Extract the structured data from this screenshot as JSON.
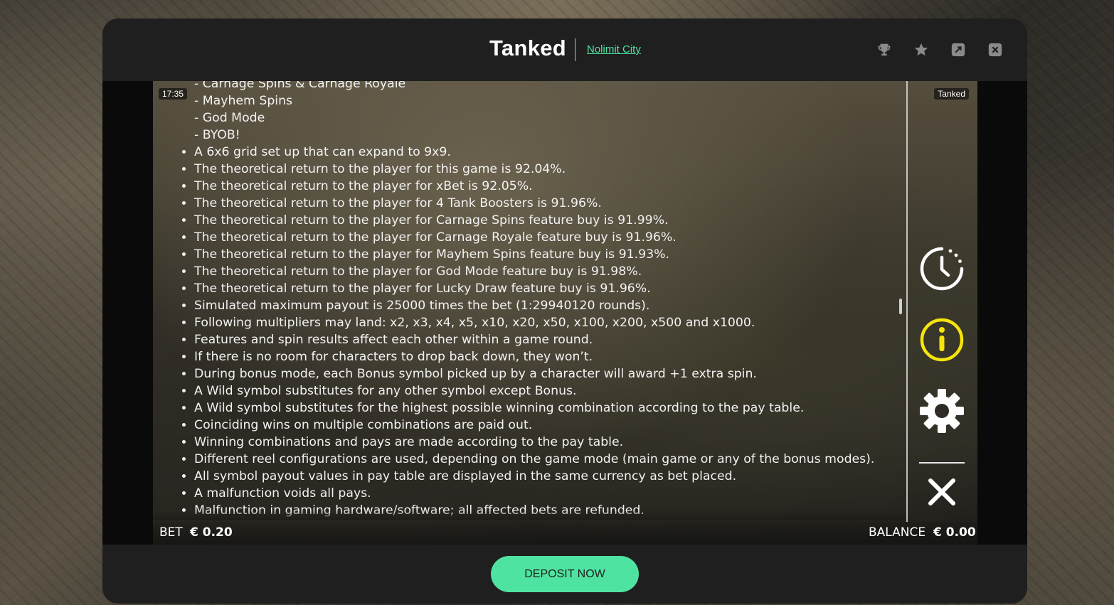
{
  "header": {
    "title": "Tanked",
    "provider": "Nolimit City",
    "icons": [
      "trophy-icon",
      "star-icon",
      "expand-icon",
      "close-icon"
    ]
  },
  "game": {
    "clock": "17:35",
    "game_label": "Tanked",
    "rules_sub_items": [
      "- Carnage Spins & Carnage Royale",
      "- Mayhem Spins",
      "- God Mode",
      "- BYOB!"
    ],
    "rules_items": [
      "A 6x6 grid set up that can expand to 9x9.",
      "The theoretical return to the player for this game is 92.04%.",
      "The theoretical return to the player for xBet is 92.05%.",
      "The theoretical return to the player for 4 Tank Boosters is 91.96%.",
      "The theoretical return to the player for Carnage Spins feature buy is 91.99%.",
      "The theoretical return to the player for Carnage Royale feature buy is 91.96%.",
      "The theoretical return to the player for Mayhem Spins feature buy is 91.93%.",
      "The theoretical return to the player for God Mode feature buy is 91.98%.",
      "The theoretical return to the player for Lucky Draw feature buy is 91.96%.",
      "Simulated maximum payout is 25000 times the bet (1:29940120 rounds).",
      "Following multipliers may land: x2, x3, x4, x5, x10, x20, x50, x100, x200, x500 and x1000.",
      "Features and spin results affect each other within a game round.",
      "If there is no room for characters to drop back down, they won’t.",
      "During bonus mode, each Bonus symbol picked up by a character will award +1 extra spin.",
      "A Wild symbol substitutes for any other symbol except Bonus.",
      "A Wild symbol substitutes for the highest possible winning combination according to the pay table.",
      "Coinciding wins on multiple combinations are paid out.",
      "Winning combinations and pays are made according to the pay table.",
      "Different reel configurations are used, depending on the game mode (main game or any of the bonus modes).",
      "All symbol payout values in pay table are displayed in the same currency as bet placed.",
      "A malfunction voids all pays.",
      "Malfunction in gaming hardware/software; all affected bets are refunded."
    ],
    "side_buttons": [
      "history-icon",
      "info-icon",
      "settings-icon",
      "close-icon"
    ],
    "accent_color": "#f5e50a",
    "bet_label": "BET",
    "bet_value": "€ 0.20",
    "balance_label": "BALANCE",
    "balance_value": "€ 0.00"
  },
  "footer": {
    "deposit_label": "DEPOSIT NOW",
    "deposit_color": "#4fe3a1"
  }
}
